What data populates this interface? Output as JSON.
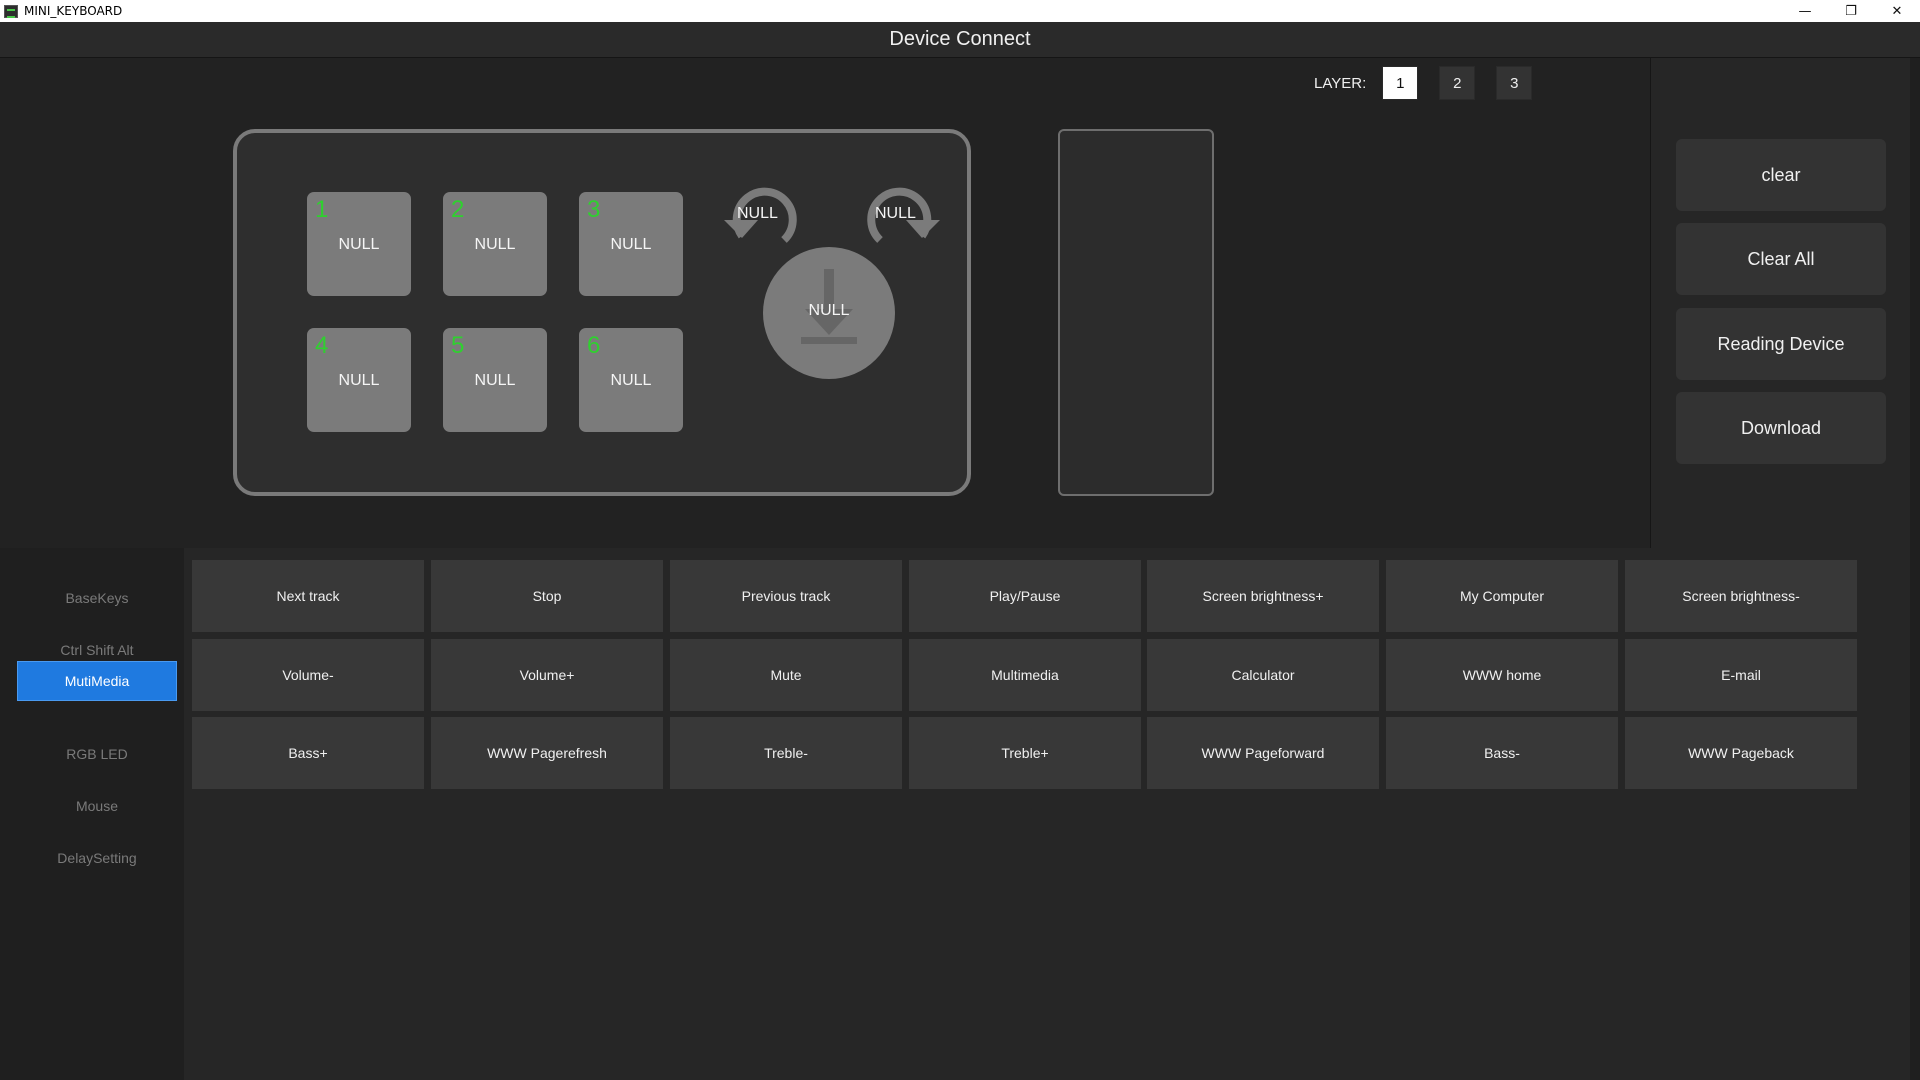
{
  "window": {
    "title": "MINI_KEYBOARD",
    "min_glyph": "—",
    "max_glyph": "❐",
    "close_glyph": "✕"
  },
  "header": {
    "title": "Device Connect"
  },
  "layers": {
    "label": "LAYER:",
    "buttons": [
      "1",
      "2",
      "3"
    ],
    "active_index": 0
  },
  "keypad": {
    "keys": [
      {
        "num": "1",
        "label": "NULL"
      },
      {
        "num": "2",
        "label": "NULL"
      },
      {
        "num": "3",
        "label": "NULL"
      },
      {
        "num": "4",
        "label": "NULL"
      },
      {
        "num": "5",
        "label": "NULL"
      },
      {
        "num": "6",
        "label": "NULL"
      }
    ],
    "knob_ccw": "NULL",
    "knob_cw": "NULL",
    "knob_press": "NULL"
  },
  "actions": [
    "clear",
    "Clear All",
    "Reading Device",
    "Download"
  ],
  "sidebar": {
    "items": [
      "BaseKeys",
      "Ctrl Shift Alt",
      "MutiMedia",
      "RGB LED",
      "Mouse",
      "DelaySetting"
    ],
    "active_index": 2
  },
  "functions": [
    [
      "Next track",
      "Stop",
      "Previous track",
      "Play/Pause",
      "Screen brightness+",
      "My Computer",
      "Screen brightness-"
    ],
    [
      "Volume-",
      "Volume+",
      "Mute",
      "Multimedia",
      "Calculator",
      "WWW home",
      "E-mail"
    ],
    [
      "Bass+",
      "WWW Pagerefresh",
      "Treble-",
      "Treble+",
      "WWW Pageforward",
      "Bass-",
      "WWW Pageback"
    ]
  ],
  "colors": {
    "accent": "#1f7ae0",
    "key_number": "#2fd02f",
    "key_face": "#7b7b7b"
  }
}
